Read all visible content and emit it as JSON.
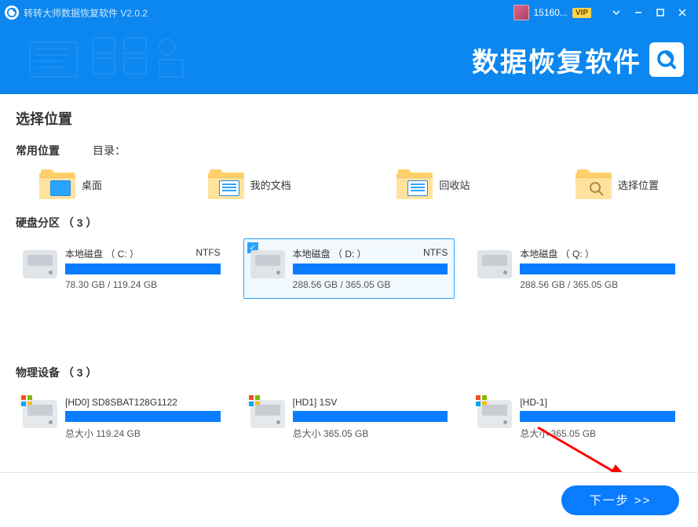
{
  "titlebar": {
    "title": "转转大师数据恢复软件 V2.0.2",
    "user_id": "15160...",
    "vip_label": "VIP"
  },
  "banner": {
    "brand_text": "数据恢复软件"
  },
  "page": {
    "heading": "选择位置"
  },
  "common": {
    "label": "常用位置",
    "dir_label": "目录：",
    "items": [
      {
        "label": "桌面"
      },
      {
        "label": "我的文档"
      },
      {
        "label": "回收站"
      },
      {
        "label": "选择位置"
      }
    ]
  },
  "partitions": {
    "title": "硬盘分区 （ 3 ）",
    "items": [
      {
        "name": "本地磁盘 （ C: ）",
        "fs": "NTFS",
        "usage": "78.30 GB / 119.24 GB",
        "selected": false
      },
      {
        "name": "本地磁盘 （ D: ）",
        "fs": "NTFS",
        "usage": "288.56 GB / 365.05 GB",
        "selected": true
      },
      {
        "name": "本地磁盘 （ Q: ）",
        "fs": "",
        "usage": "288.56 GB / 365.05 GB",
        "selected": false
      }
    ]
  },
  "devices": {
    "title": "物理设备 （ 3 ）",
    "items": [
      {
        "name": "[HD0] SD8SBAT128G1122",
        "size": "总大小 119.24 GB"
      },
      {
        "name": "[HD1] 1SV",
        "size": "总大小 365.05 GB"
      },
      {
        "name": "[HD-1]",
        "size": "总大小 365.05 GB"
      }
    ]
  },
  "footer": {
    "next_label": "下一步 >>"
  }
}
